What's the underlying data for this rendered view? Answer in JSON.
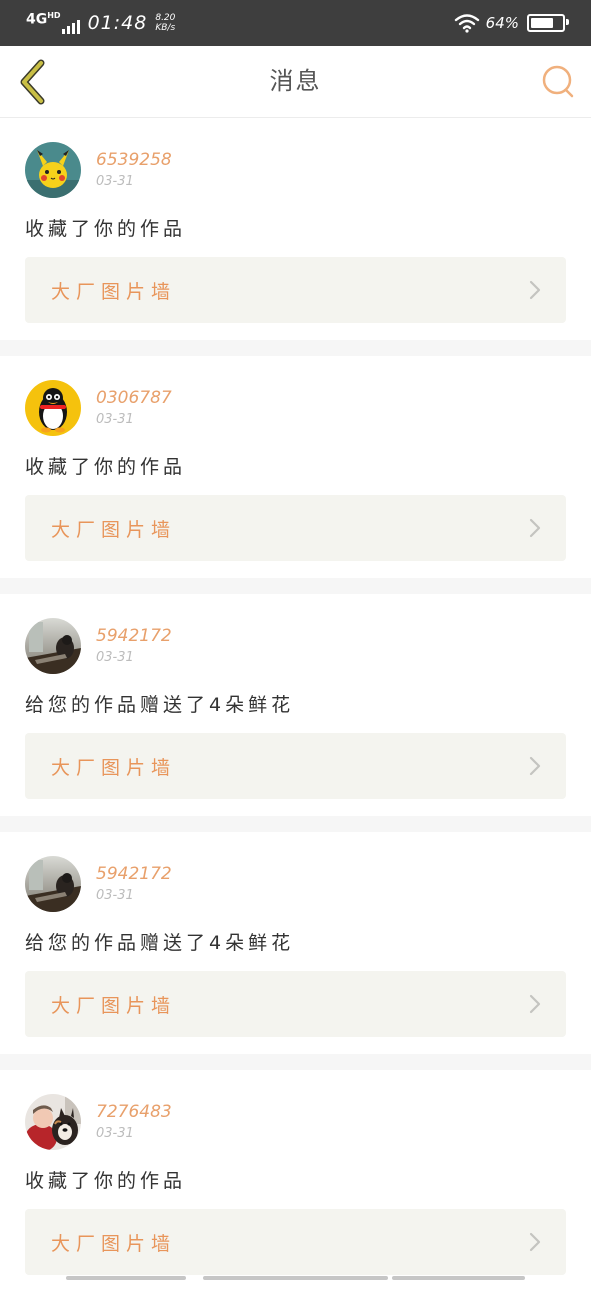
{
  "status_bar": {
    "network": "4G",
    "network_sup": "HD",
    "time": "01:48",
    "speed_value": "8.20",
    "speed_unit": "KB/s",
    "battery": "64%",
    "battery_level": 0.64
  },
  "header": {
    "title": "消息",
    "back_icon": "chevron-left-icon",
    "search_icon": "search-icon"
  },
  "colors": {
    "accent": "#e8955a",
    "back": "#c9bf45",
    "card_bg": "#f4f4ef",
    "separator": "#f6f6f6"
  },
  "messages": [
    {
      "username": "6539258",
      "date": "03-31",
      "action": "收藏了你的作品",
      "work": "大厂图片墙",
      "avatar": "pikachu"
    },
    {
      "username": "0306787",
      "date": "03-31",
      "action": "收藏了你的作品",
      "work": "大厂图片墙",
      "avatar": "penguin"
    },
    {
      "username": "5942172",
      "date": "03-31",
      "action": "给您的作品赠送了4朵鲜花",
      "work": "大厂图片墙",
      "avatar": "photo"
    },
    {
      "username": "5942172",
      "date": "03-31",
      "action": "给您的作品赠送了4朵鲜花",
      "work": "大厂图片墙",
      "avatar": "photo"
    },
    {
      "username": "7276483",
      "date": "03-31",
      "action": "收藏了你的作品",
      "work": "大厂图片墙",
      "avatar": "dog"
    }
  ]
}
